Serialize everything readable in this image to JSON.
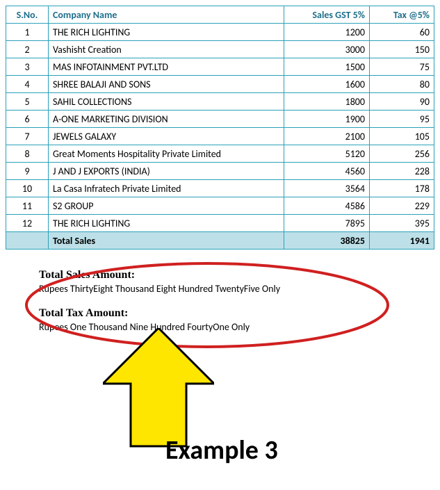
{
  "chart_data": {
    "type": "table",
    "title": "Sales GST 5% and Tax @5% by Company",
    "columns": [
      "S.No.",
      "Company Name",
      "Sales GST 5%",
      "Tax @5%"
    ],
    "rows": [
      {
        "sno": 1,
        "company": "THE RICH LIGHTING",
        "sales": 1200,
        "tax": 60
      },
      {
        "sno": 2,
        "company": "Vashisht Creation",
        "sales": 3000,
        "tax": 150
      },
      {
        "sno": 3,
        "company": "MAS INFOTAINMENT PVT.LTD",
        "sales": 1500,
        "tax": 75
      },
      {
        "sno": 4,
        "company": "SHREE BALAJI AND SONS",
        "sales": 1600,
        "tax": 80
      },
      {
        "sno": 5,
        "company": "SAHIL COLLECTIONS",
        "sales": 1800,
        "tax": 90
      },
      {
        "sno": 6,
        "company": "A-ONE MARKETING DIVISION",
        "sales": 1900,
        "tax": 95
      },
      {
        "sno": 7,
        "company": "JEWELS GALAXY",
        "sales": 2100,
        "tax": 105
      },
      {
        "sno": 8,
        "company": "Great Moments Hospitality Private Limited",
        "sales": 5120,
        "tax": 256
      },
      {
        "sno": 9,
        "company": "J AND J EXPORTS (INDIA)",
        "sales": 4560,
        "tax": 228
      },
      {
        "sno": 10,
        "company": "La Casa Infratech Private Limited",
        "sales": 3564,
        "tax": 178
      },
      {
        "sno": 11,
        "company": "S2 GROUP",
        "sales": 4586,
        "tax": 229
      },
      {
        "sno": 12,
        "company": "THE RICH LIGHTING",
        "sales": 7895,
        "tax": 395
      }
    ],
    "totals": {
      "label": "Total Sales",
      "sales": 38825,
      "tax": 1941
    }
  },
  "headers": {
    "sno": "S.No.",
    "company": "Company Name",
    "sales": "Sales GST 5%",
    "tax": "Tax @5%"
  },
  "totals_row": {
    "label": "Total Sales",
    "sales": "38825",
    "tax": "1941"
  },
  "amounts": {
    "sales_heading": "Total Sales Amount:",
    "sales_words": "Rupees ThirtyEight Thousand Eight Hundred TwentyFive Only",
    "tax_heading": "Total Tax Amount:",
    "tax_words": "Rupees One Thousand Nine Hundred FourtyOne Only"
  },
  "annotation": {
    "example_label": "Example 3"
  }
}
